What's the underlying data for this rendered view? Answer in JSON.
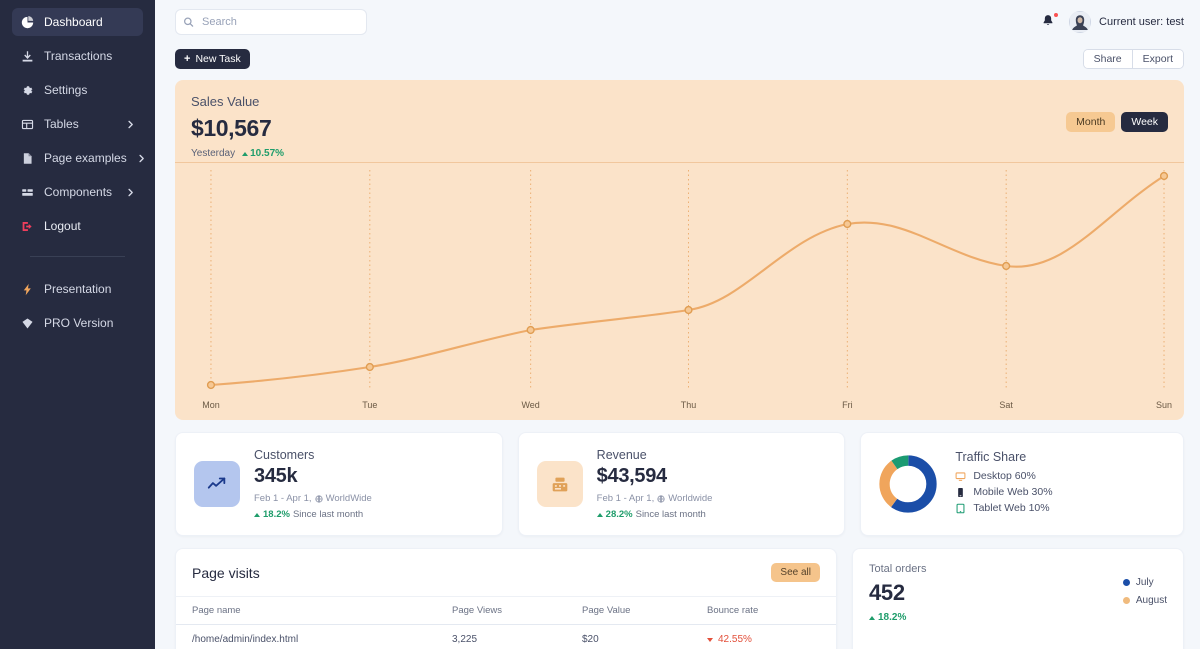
{
  "sidebar": {
    "items": [
      {
        "label": "Dashboard",
        "icon": "pie-chart-icon",
        "active": true,
        "chevron": false
      },
      {
        "label": "Transactions",
        "icon": "download-icon",
        "active": false,
        "chevron": false
      },
      {
        "label": "Settings",
        "icon": "gear-icon",
        "active": false,
        "chevron": false
      },
      {
        "label": "Tables",
        "icon": "table-icon",
        "active": false,
        "chevron": true
      },
      {
        "label": "Page examples",
        "icon": "file-icon",
        "active": false,
        "chevron": true
      },
      {
        "label": "Components",
        "icon": "components-icon",
        "active": false,
        "chevron": true
      },
      {
        "label": "Logout",
        "icon": "logout-icon",
        "active": false,
        "chevron": false
      }
    ],
    "footer_items": [
      {
        "label": "Presentation",
        "icon": "bolt-icon"
      },
      {
        "label": "PRO Version",
        "icon": "diamond-icon"
      }
    ],
    "bg_color": "#262b40",
    "active_bg_color": "#343a55"
  },
  "topbar": {
    "search_placeholder": "Search",
    "search_value": "",
    "user_label": "Current user: test",
    "notification_dot_color": "#fa5252"
  },
  "actions": {
    "new_task_label": "New Task",
    "new_task_plus": "+",
    "share_label": "Share",
    "export_label": "Export"
  },
  "sales_card": {
    "title": "Sales Value",
    "value": "$10,567",
    "period_label": "Yesterday",
    "change": "10.57%",
    "change_direction": "up",
    "toggle_month": "Month",
    "toggle_week": "Week",
    "active_toggle": "Week",
    "bg_color": "#fbe3c9",
    "line_color": "#edab6a"
  },
  "chart_data": {
    "type": "line",
    "title": "Sales Value",
    "xlabel": "",
    "ylabel": "",
    "categories": [
      "Mon",
      "Tue",
      "Wed",
      "Thu",
      "Fri",
      "Sat",
      "Sun"
    ],
    "values": [
      5,
      15,
      35,
      46,
      80,
      62,
      100
    ],
    "ylim": [
      0,
      105
    ],
    "grid": true,
    "grid_style": "vertical-dotted",
    "legend": "none",
    "series": [
      {
        "name": "Sales Value",
        "values": [
          5,
          15,
          35,
          46,
          80,
          62,
          100
        ],
        "color": "#edab6a"
      }
    ]
  },
  "stat_cards": [
    {
      "label": "Customers",
      "value": "345k",
      "range": "Feb 1 - Apr 1,",
      "scope": "WorldWide",
      "delta": "18.2%",
      "delta_direction": "up",
      "delta_suffix": "Since last month",
      "icon": "chart-line-icon",
      "icon_style": "blue"
    },
    {
      "label": "Revenue",
      "value": "$43,594",
      "range": "Feb 1 - Apr 1,",
      "scope": "Worldwide",
      "delta": "28.2%",
      "delta_direction": "up",
      "delta_suffix": "Since last month",
      "icon": "cash-register-icon",
      "icon_style": "peach"
    }
  ],
  "traffic_share": {
    "title": "Traffic Share",
    "items": [
      {
        "label": "Desktop 60%",
        "icon": "desktop-icon",
        "color": "#1b4ea8",
        "value": 60
      },
      {
        "label": "Mobile Web 30%",
        "icon": "mobile-icon",
        "color": "#f0a55c",
        "value": 30
      },
      {
        "label": "Tablet Web 10%",
        "icon": "tablet-icon",
        "color": "#1b9b72",
        "value": 10
      }
    ],
    "chart_data": {
      "type": "pie",
      "labels": [
        "Desktop",
        "Mobile Web",
        "Tablet Web"
      ],
      "values": [
        60,
        30,
        10
      ],
      "colors": [
        "#1b4ea8",
        "#f0a55c",
        "#1b9b72"
      ]
    }
  },
  "page_visits": {
    "title": "Page visits",
    "see_all_label": "See all",
    "columns": [
      "Page name",
      "Page Views",
      "Page Value",
      "Bounce rate"
    ],
    "rows": [
      {
        "page_name": "/home/admin/index.html",
        "page_views": "3,225",
        "page_value": "$20",
        "bounce_rate": "42.55%",
        "bounce_direction": "down"
      }
    ]
  },
  "total_orders": {
    "label": "Total orders",
    "value": "452",
    "delta": "18.2%",
    "delta_direction": "up",
    "legend": [
      {
        "label": "July",
        "color": "#1b4ea8"
      },
      {
        "label": "August",
        "color": "#f0bb7e"
      }
    ]
  }
}
